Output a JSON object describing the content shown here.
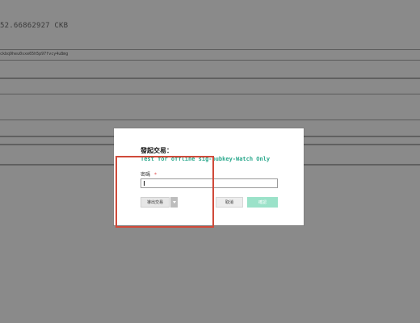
{
  "background": {
    "balance_text": "52.66862927 CKB",
    "address_text": "ckbq9heu0sxe65h5p97fvcy4u8mg"
  },
  "dialog": {
    "title": "發起交易：",
    "subtitle": "Test for offline sig-pubkey-Watch Only",
    "password_label": "密碼",
    "required_mark": "*",
    "password_value": "",
    "buttons": {
      "export": "導出交易",
      "cancel": "取消",
      "confirm": "確認"
    }
  },
  "colors": {
    "overlay": "#8a8a8a",
    "accent_text": "#2aa88c",
    "confirm_bg": "#9be2c9",
    "annotation": "#d04a3a"
  }
}
